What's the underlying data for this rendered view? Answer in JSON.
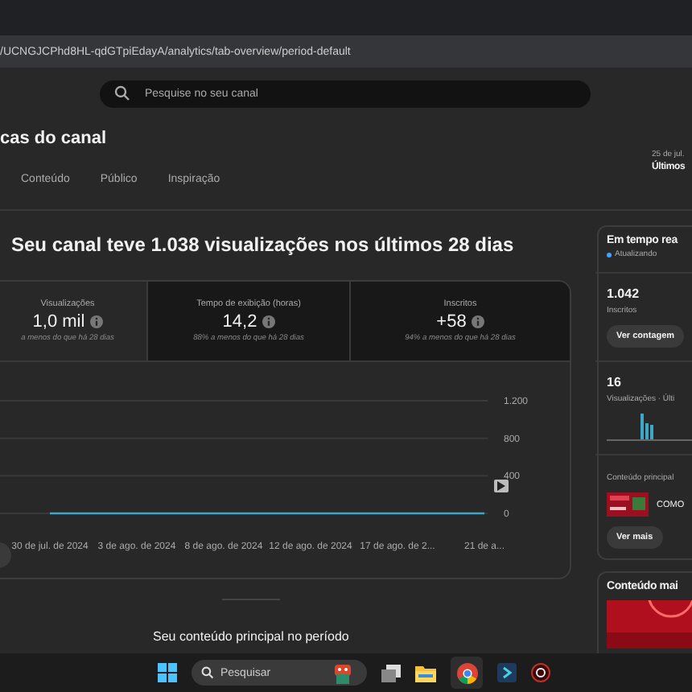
{
  "address_bar": {
    "url": "/UCNGJCPhd8HL-qdGTpiEdayA/analytics/tab-overview/period-default"
  },
  "search": {
    "placeholder": "Pesquise no seu canal"
  },
  "page_title": "cas do canal",
  "tabs": [
    {
      "label": "Conteúdo",
      "selected": false
    },
    {
      "label": "Público",
      "selected": false
    },
    {
      "label": "Inspiração",
      "selected": false
    }
  ],
  "period": {
    "range": "25 de jul.",
    "label": "Últimos"
  },
  "headline": "Seu canal teve 1.038 visualizações nos últimos 28 dias",
  "stats": [
    {
      "label": "Visualizações",
      "value": "1,0 mil",
      "note": "a menos do que há 28 dias",
      "selected": true
    },
    {
      "label": "Tempo de exibição (horas)",
      "value": "14,2",
      "note": "88% a menos do que há 28 dias",
      "selected": false
    },
    {
      "label": "Inscritos",
      "value": "+58",
      "note": "94% a menos do que há 28 dias",
      "selected": false
    }
  ],
  "chart": {
    "chart_data": {
      "type": "line",
      "x": [
        "30 de jul. de 2024",
        "3 de ago. de 2024",
        "8 de ago. de 2024",
        "12 de ago. de 2024",
        "17 de ago. de 2...",
        "21 de a..."
      ],
      "series": [
        {
          "color": "#3ea6c7",
          "values": [
            0,
            0,
            0,
            0,
            0,
            0
          ]
        }
      ],
      "ylim": [
        0,
        1200
      ],
      "yticks": [
        0,
        400,
        800,
        {
          "value": 1200,
          "label": "1.200"
        }
      ]
    }
  },
  "section_heading": "Seu conteúdo principal no período",
  "realtime": {
    "title": "Em tempo rea",
    "status": "Atualizando",
    "subscribers": "1.042",
    "subscribers_label": "Inscritos",
    "count_button": "Ver contagem",
    "views": "16",
    "views_label": "Visualizações · Últi",
    "top_label": "Conteúdo principal",
    "top_item": "COMO",
    "more_button": "Ver mais"
  },
  "top_content": {
    "title": "Conteúdo mai"
  },
  "taskbar": {
    "search_placeholder": "Pesquisar"
  }
}
